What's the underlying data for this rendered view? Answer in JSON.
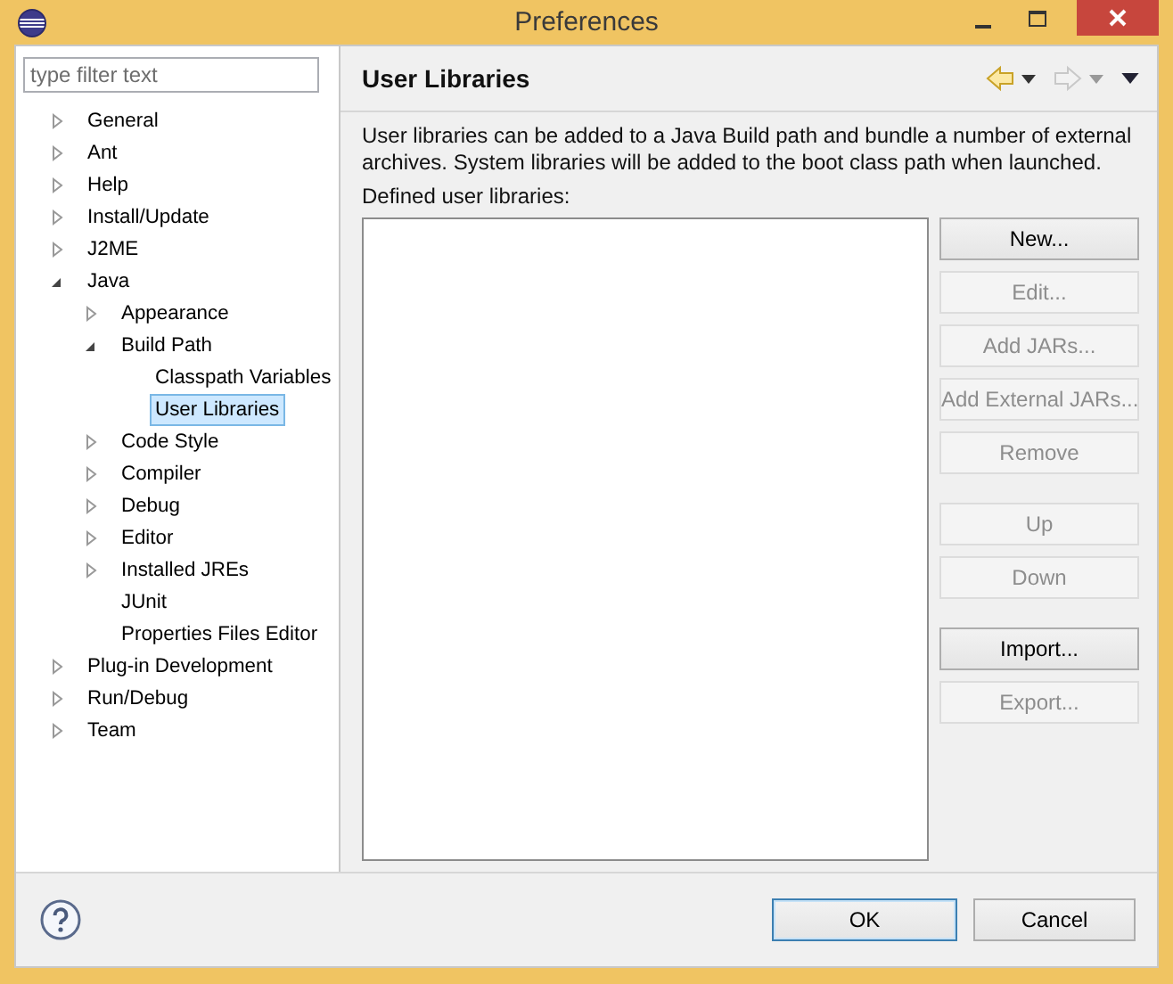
{
  "window": {
    "title": "Preferences"
  },
  "filter": {
    "placeholder": "type filter text"
  },
  "tree": [
    {
      "label": "General",
      "expanded": false,
      "selected": false
    },
    {
      "label": "Ant",
      "expanded": false,
      "selected": false
    },
    {
      "label": "Help",
      "expanded": false,
      "selected": false
    },
    {
      "label": "Install/Update",
      "expanded": false,
      "selected": false
    },
    {
      "label": "J2ME",
      "expanded": false,
      "selected": false
    },
    {
      "label": "Java",
      "expanded": true,
      "selected": false,
      "children": [
        {
          "label": "Appearance",
          "expanded": false,
          "selected": false
        },
        {
          "label": "Build Path",
          "expanded": true,
          "selected": false,
          "children": [
            {
              "label": "Classpath Variables",
              "selected": false
            },
            {
              "label": "User Libraries",
              "selected": true
            }
          ]
        },
        {
          "label": "Code Style",
          "expanded": false,
          "selected": false
        },
        {
          "label": "Compiler",
          "expanded": false,
          "selected": false
        },
        {
          "label": "Debug",
          "expanded": false,
          "selected": false
        },
        {
          "label": "Editor",
          "expanded": false,
          "selected": false
        },
        {
          "label": "Installed JREs",
          "expanded": false,
          "selected": false
        },
        {
          "label": "JUnit",
          "selected": false
        },
        {
          "label": "Properties Files Editor",
          "selected": false
        }
      ]
    },
    {
      "label": "Plug-in Development",
      "expanded": false,
      "selected": false
    },
    {
      "label": "Run/Debug",
      "expanded": false,
      "selected": false
    },
    {
      "label": "Team",
      "expanded": false,
      "selected": false
    }
  ],
  "page": {
    "title": "User Libraries",
    "back_disabled": false,
    "forward_disabled": true,
    "description": "User libraries can be added to a Java Build path and bundle a number of external archives. System libraries will be added to the boot class path when launched.",
    "list_label": "Defined user libraries:",
    "button_groups": [
      [
        {
          "label": "New...",
          "disabled": false
        },
        {
          "label": "Edit...",
          "disabled": true
        },
        {
          "label": "Add JARs...",
          "disabled": true
        },
        {
          "label": "Add External JARs...",
          "disabled": true
        },
        {
          "label": "Remove",
          "disabled": true
        }
      ],
      [
        {
          "label": "Up",
          "disabled": true
        },
        {
          "label": "Down",
          "disabled": true
        }
      ],
      [
        {
          "label": "Import...",
          "disabled": false
        },
        {
          "label": "Export...",
          "disabled": true
        }
      ]
    ]
  },
  "footer": {
    "buttons": [
      {
        "label": "OK",
        "default": true
      },
      {
        "label": "Cancel",
        "default": false
      }
    ]
  }
}
